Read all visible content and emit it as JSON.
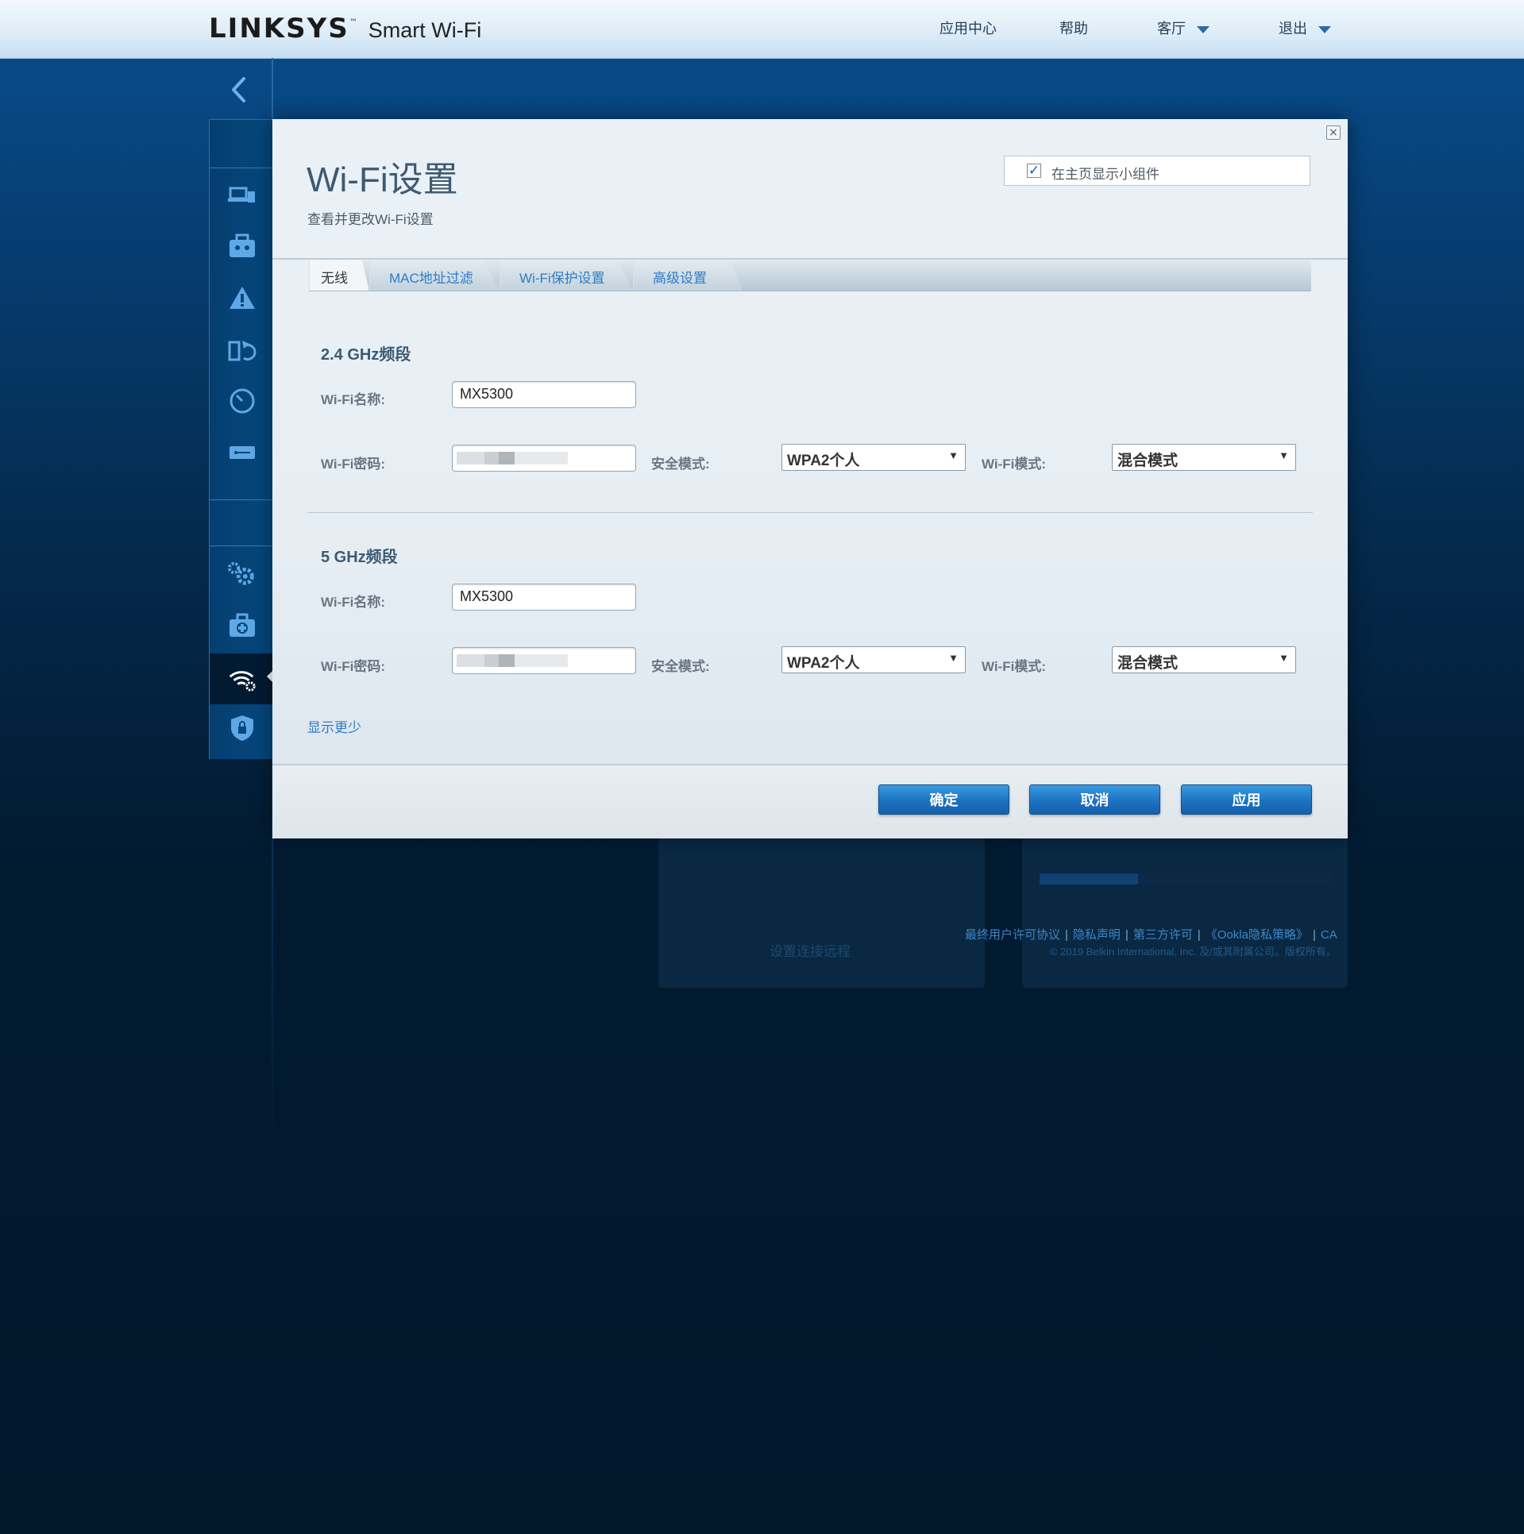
{
  "header": {
    "brand": "LINKSYS",
    "trademark": "™",
    "product": "Smart Wi-Fi",
    "nav": {
      "app_center": "应用中心",
      "help": "帮助",
      "guest": "客厅",
      "logout": "退出"
    }
  },
  "background": {
    "footer_links": [
      "最终用户许可协议",
      "隐私声明",
      "第三方许可",
      "《Ookla隐私策略》",
      "CA"
    ],
    "copyright": "© 2019 Belkin International, Inc. 及/或其附属公司。版权所有。",
    "card_text": "设置连接远程"
  },
  "modal": {
    "title": "Wi-Fi设置",
    "subtitle": "查看并更改Wi-Fi设置",
    "show_widget_label": "在主页显示小组件",
    "show_widget_checked": true,
    "tabs": [
      {
        "label": "无线",
        "active": true
      },
      {
        "label": "MAC地址过滤",
        "active": false
      },
      {
        "label": "Wi-Fi保护设置",
        "active": false
      },
      {
        "label": "高级设置",
        "active": false
      }
    ],
    "bands": [
      {
        "title": "2.4 GHz频段",
        "name_label": "Wi-Fi名称:",
        "name_value": "MX5300",
        "password_label": "Wi-Fi密码:",
        "security_label": "安全模式:",
        "security_value": "WPA2个人",
        "mode_label": "Wi-Fi模式:",
        "mode_value": "混合模式"
      },
      {
        "title": "5 GHz频段",
        "name_label": "Wi-Fi名称:",
        "name_value": "MX5300",
        "password_label": "Wi-Fi密码:",
        "security_label": "安全模式:",
        "security_value": "WPA2个人",
        "mode_label": "Wi-Fi模式:",
        "mode_value": "混合模式"
      }
    ],
    "show_less": "显示更少",
    "buttons": {
      "ok": "确定",
      "cancel": "取消",
      "apply": "应用"
    }
  },
  "colors": {
    "accent": "#2f7cc4",
    "button": "#1d72c2",
    "background_top": "#0a4f8d",
    "background_bottom": "#02182b"
  }
}
